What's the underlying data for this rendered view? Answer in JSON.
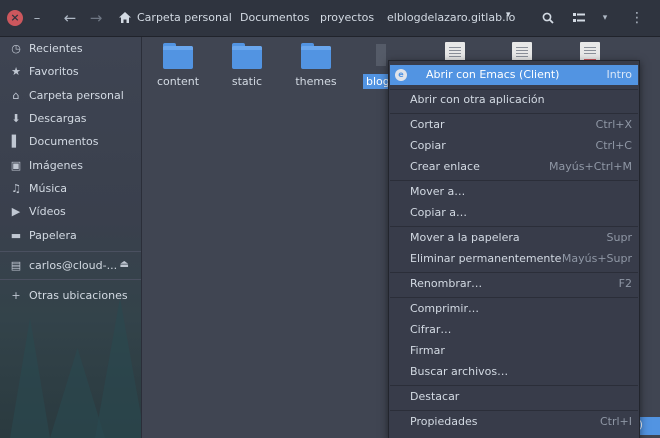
{
  "header": {
    "breadcrumbs": [
      "Carpeta personal",
      "Documentos",
      "proyectos",
      "elblogdelazaro.gitlab.io"
    ],
    "close_glyph": "×",
    "minimize_glyph": "–",
    "back_glyph": "←",
    "forward_glyph": "→",
    "view_menu_glyph": "▾",
    "app_menu_glyph": "⋮",
    "crumb_arrow_glyph": "▾"
  },
  "sidebar": {
    "items": [
      {
        "label": "Recientes",
        "icon": "clock-icon",
        "glyph": "◷"
      },
      {
        "label": "Favoritos",
        "icon": "star-icon",
        "glyph": "★"
      },
      {
        "label": "Carpeta personal",
        "icon": "home-icon",
        "glyph": "⌂"
      },
      {
        "label": "Descargas",
        "icon": "download-icon",
        "glyph": "⬇"
      },
      {
        "label": "Documentos",
        "icon": "document-icon",
        "glyph": "▌"
      },
      {
        "label": "Imágenes",
        "icon": "image-icon",
        "glyph": "▣"
      },
      {
        "label": "Música",
        "icon": "music-icon",
        "glyph": "♫"
      },
      {
        "label": "Vídeos",
        "icon": "video-icon",
        "glyph": "▶"
      },
      {
        "label": "Papelera",
        "icon": "trash-icon",
        "glyph": "▬"
      }
    ],
    "network_drive": {
      "label": "carlos@cloud-...",
      "icon": "drive-icon",
      "glyph": "▤",
      "eject_glyph": "⏏"
    },
    "other_locations": {
      "label": "Otras ubicaciones",
      "icon": "plus-icon",
      "glyph": "+"
    }
  },
  "files": {
    "folders": [
      "content",
      "static",
      "themes"
    ],
    "selected_label": "blog",
    "bottom_tag": ")"
  },
  "context_menu": {
    "items": [
      {
        "label": "Abrir con Emacs (Client)",
        "accel": "Intro",
        "icon": "emacs-icon",
        "icon_glyph": "e"
      },
      {
        "label": "Abrir con otra aplicación",
        "accel": ""
      },
      {
        "label": "Cortar",
        "accel": "Ctrl+X"
      },
      {
        "label": "Copiar",
        "accel": "Ctrl+C"
      },
      {
        "label": "Crear enlace",
        "accel": "Mayús+Ctrl+M"
      },
      {
        "label": "Mover a…",
        "accel": ""
      },
      {
        "label": "Copiar a…",
        "accel": ""
      },
      {
        "label": "Mover a la papelera",
        "accel": "Supr"
      },
      {
        "label": "Eliminar permanentemente",
        "accel": "Mayús+Supr"
      },
      {
        "label": "Renombrar…",
        "accel": "F2"
      },
      {
        "label": "Comprimir…",
        "accel": ""
      },
      {
        "label": "Cifrar…",
        "accel": ""
      },
      {
        "label": "Firmar",
        "accel": ""
      },
      {
        "label": "Buscar archivos…",
        "accel": ""
      },
      {
        "label": "Destacar",
        "accel": ""
      },
      {
        "label": "Propiedades",
        "accel": "Ctrl+I"
      }
    ]
  },
  "colors": {
    "accent": "#5294e2",
    "close": "#cc575d",
    "bg": "#383c4a"
  }
}
